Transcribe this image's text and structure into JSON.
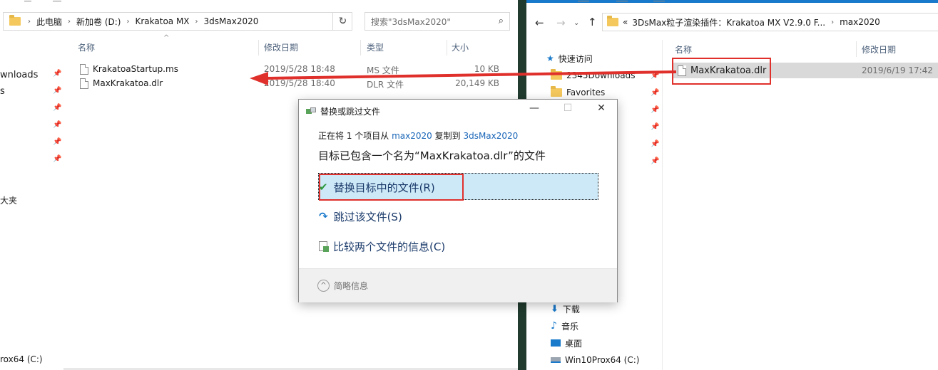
{
  "left": {
    "breadcrumb": [
      "此电脑",
      "新加卷 (D:)",
      "Krakatoa MX",
      "3dsMax2020"
    ],
    "search_placeholder": "搜索\"3dsMax2020\"",
    "columns": {
      "name": "名称",
      "date": "修改日期",
      "type": "类型",
      "size": "大小"
    },
    "files": [
      {
        "name": "KrakatoaStartup.ms",
        "date": "2019/5/28 18:48",
        "type": "MS 文件",
        "size": "10 KB"
      },
      {
        "name": "MaxKrakatoa.dlr",
        "date": "2019/5/28 18:40",
        "type": "DLR 文件",
        "size": "20,149 KB"
      }
    ],
    "nav_items": [
      "wnloads",
      "s",
      "大夹",
      "rox64 (C:)"
    ],
    "pin": "📌"
  },
  "right": {
    "breadcrumb_prefix": "«",
    "breadcrumb": [
      "3DsMax粒子渲染插件：Krakatoa MX V2.9.0 F...",
      "max2020"
    ],
    "columns": {
      "name": "名称",
      "date": "修改日期"
    },
    "files": [
      {
        "name": "MaxKrakatoa.dlr",
        "date": "2019/6/19 17:42"
      }
    ],
    "nav_quick": "快速访问",
    "nav_items": [
      "2345Downloads",
      "Favorites"
    ],
    "nav_bottom": [
      "下载",
      "音乐",
      "桌面",
      "Win10Prox64 (C:)"
    ],
    "pin": "📌"
  },
  "dialog": {
    "title": "替换或跳过文件",
    "line1_prefix": "正在将 1 个项目从",
    "line1_from": "max2020",
    "line1_mid": "复制到",
    "line1_to": "3dsMax2020",
    "message": "目标已包含一个名为“MaxKrakatoa.dlr”的文件",
    "options": {
      "replace": "替换目标中的文件(R)",
      "skip": "跳过该文件(S)",
      "compare": "比较两个文件的信息(C)"
    },
    "details": "简略信息",
    "minimize": "—",
    "maximize": "☐",
    "close": "✕"
  },
  "colors": {
    "arrow": "#e0302c",
    "highlight": "#cde8f7",
    "divider": "#213b2e",
    "link": "#1a66b8"
  }
}
